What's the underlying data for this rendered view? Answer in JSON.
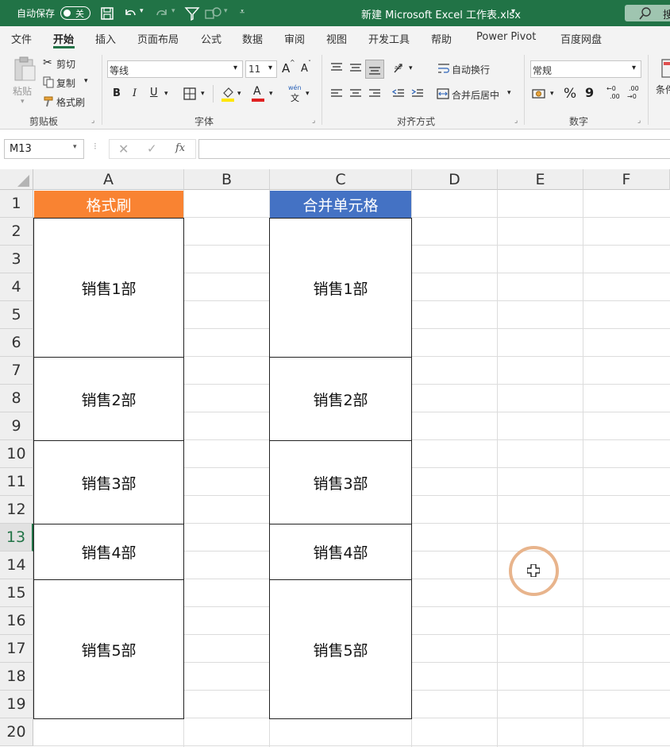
{
  "title_bar": {
    "autosave_label": "自动保存",
    "autosave_toggle": "关",
    "filename": "新建 Microsoft Excel 工作表.xlsx",
    "search_label": "搜"
  },
  "menu": [
    "文件",
    "开始",
    "插入",
    "页面布局",
    "公式",
    "数据",
    "审阅",
    "视图",
    "开发工具",
    "帮助",
    "Power Pivot",
    "百度网盘"
  ],
  "ribbon": {
    "clipboard": {
      "paste": "粘贴",
      "cut": "剪切",
      "copy": "复制",
      "format_painter": "格式刷",
      "group": "剪贴板"
    },
    "font": {
      "name": "等线",
      "size": "11",
      "group": "字体",
      "grow": "A",
      "shrink": "A",
      "bold": "B",
      "italic": "I",
      "underline": "U",
      "phonetic": "wén"
    },
    "alignment": {
      "wrap": "自动换行",
      "merge": "合并后居中",
      "group": "对齐方式"
    },
    "number": {
      "format": "常规",
      "percent": "%",
      "comma": "9",
      "group": "数字",
      "inc_decimal": ".00",
      "dec_decimal": ".00"
    },
    "styles": {
      "conditional": "条件"
    }
  },
  "formula_bar": {
    "name_box": "M13",
    "fx": "fx",
    "formula": ""
  },
  "columns": [
    "A",
    "B",
    "C",
    "D",
    "E",
    "F"
  ],
  "rows": [
    "1",
    "2",
    "3",
    "4",
    "5",
    "6",
    "7",
    "8",
    "9",
    "10",
    "11",
    "12",
    "13",
    "14",
    "15",
    "16",
    "17",
    "18",
    "19",
    "20"
  ],
  "selected_row": "13",
  "cells": {
    "A1": "格式刷",
    "C1": "合并单元格",
    "A_blocks": [
      "销售1部",
      "销售2部",
      "销售3部",
      "销售4部",
      "销售5部"
    ],
    "C_blocks": [
      "销售1部",
      "销售2部",
      "销售3部",
      "销售4部",
      "销售5部"
    ]
  },
  "colors": {
    "excel_green": "#217346",
    "a1_fill": "#F98332",
    "c1_fill": "#4472C4",
    "cursor_ring": "#E8B48C"
  }
}
